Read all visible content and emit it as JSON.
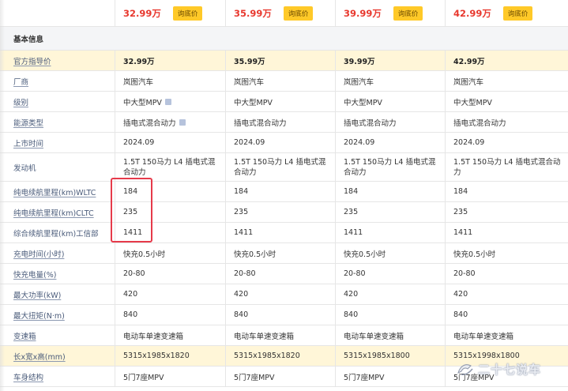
{
  "price_row": {
    "prices": [
      "32.99万",
      "35.99万",
      "39.99万",
      "42.99万"
    ],
    "button_label": "询底价"
  },
  "section": {
    "title": "基本信息"
  },
  "rows": [
    {
      "label": "官方指导价",
      "values": [
        "32.99万",
        "35.99万",
        "39.99万",
        "42.99万"
      ]
    },
    {
      "label": "厂商",
      "values": [
        "岚图汽车",
        "岚图汽车",
        "岚图汽车",
        "岚图汽车"
      ]
    },
    {
      "label": "级别",
      "values": [
        "中大型MPV",
        "中大型MPV",
        "中大型MPV",
        "中大型MPV"
      ]
    },
    {
      "label": "能源类型",
      "values": [
        "插电式混合动力",
        "插电式混合动力",
        "插电式混合动力",
        "插电式混合动力"
      ]
    },
    {
      "label": "上市时间",
      "values": [
        "2024.09",
        "2024.09",
        "2024.09",
        "2024.09"
      ]
    },
    {
      "label": "发动机",
      "values": [
        "1.5T 150马力 L4 插电式混合动力",
        "1.5T 150马力 L4 插电式混合动力",
        "1.5T 150马力 L4 插电式混合动力",
        "1.5T 150马力 L4 插电式混合动力"
      ]
    },
    {
      "label": "纯电续航里程(km)WLTC",
      "values": [
        "184",
        "184",
        "184",
        "184"
      ]
    },
    {
      "label": "纯电续航里程(km)CLTC",
      "values": [
        "235",
        "235",
        "235",
        "235"
      ]
    },
    {
      "label": "综合续航里程(km)工信部",
      "values": [
        "1411",
        "1411",
        "1411",
        "1411"
      ]
    },
    {
      "label": "充电时间(小时)",
      "values": [
        "快充0.5小时",
        "快充0.5小时",
        "快充0.5小时",
        "快充0.5小时"
      ]
    },
    {
      "label": "快充电量(%)",
      "values": [
        "20-80",
        "20-80",
        "20-80",
        "20-80"
      ]
    },
    {
      "label": "最大功率(kW)",
      "values": [
        "420",
        "420",
        "420",
        "420"
      ]
    },
    {
      "label": "最大扭矩(N·m)",
      "values": [
        "840",
        "840",
        "840",
        "840"
      ]
    },
    {
      "label": "变速箱",
      "values": [
        "电动车单速变速箱",
        "电动车单速变速箱",
        "电动车单速变速箱",
        "电动车单速变速箱"
      ]
    },
    {
      "label": "长x宽x高(mm)",
      "values": [
        "5315x1985x1820",
        "5315x1985x1820",
        "5315x1985x1800",
        "5315x1998x1800"
      ]
    },
    {
      "label": "车身结构",
      "values": [
        "5门7座MPV",
        "5门7座MPV",
        "5门7座MPV",
        "5门7座MPV"
      ]
    }
  ],
  "watermark": {
    "text": "二十七说车"
  },
  "colors": {
    "price": "#e8392f",
    "button": "#ffc928",
    "highlight_row": "#fff6d8",
    "section_bg": "#f4f5f7",
    "annotation_box": "#e63a4a"
  },
  "icons": {
    "info": "info-icon"
  }
}
